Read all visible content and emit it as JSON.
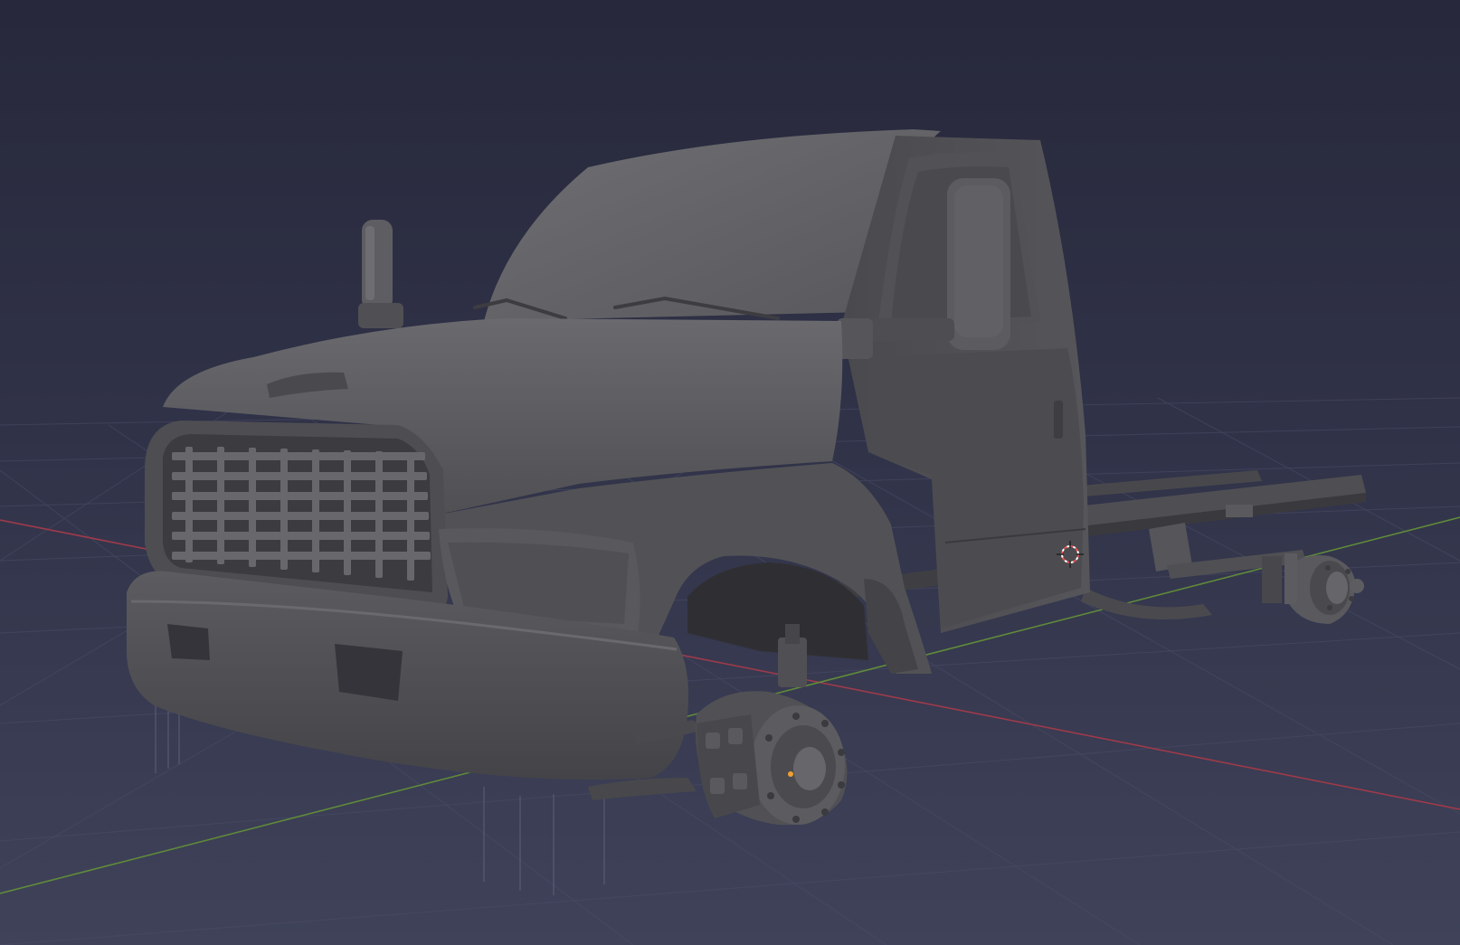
{
  "viewport": {
    "kind": "3d-viewport",
    "shading": "solid",
    "colors": {
      "background_top": "#2a2b40",
      "background_bottom": "#3e4159",
      "grid": "#4d506b",
      "x_axis": "#a03848",
      "y_axis": "#5f8a3a",
      "model": "#5a5a5e",
      "model_dark": "#3e3e42",
      "model_light": "#6c6c70"
    }
  },
  "scene": {
    "object": "truck-cab-and-chassis",
    "has_3d_cursor": true,
    "has_origin_point": true
  }
}
